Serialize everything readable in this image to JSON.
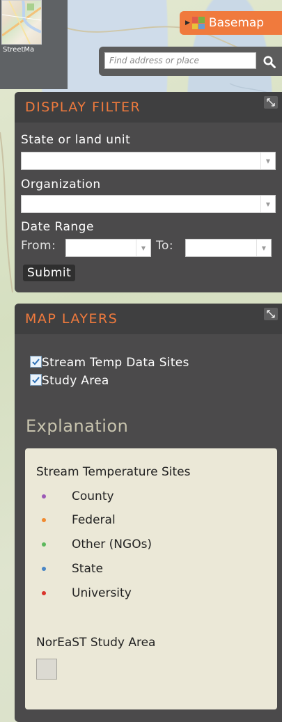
{
  "basemap_thumbnail": {
    "label": "StreetMa"
  },
  "basemap_button": {
    "label": "Basemap"
  },
  "search": {
    "placeholder": "Find address or place"
  },
  "display_filter": {
    "title": "DISPLAY FILTER",
    "state_label": "State or land unit",
    "state_value": "",
    "organization_label": "Organization",
    "organization_value": "",
    "date_range_label": "Date Range",
    "from_label": "From:",
    "to_label": "To:",
    "submit_label": "Submit"
  },
  "map_layers": {
    "title": "MAP LAYERS",
    "layers": [
      {
        "label": "Stream Temp Data Sites",
        "checked": true
      },
      {
        "label": "Study Area",
        "checked": true
      }
    ],
    "explanation_title": "Explanation",
    "legend": {
      "heading": "Stream Temperature Sites",
      "items": [
        {
          "label": "County",
          "color": "#9b59b6"
        },
        {
          "label": "Federal",
          "color": "#f08a30"
        },
        {
          "label": "Other (NGOs)",
          "color": "#5cb85c"
        },
        {
          "label": "State",
          "color": "#4a86c5"
        },
        {
          "label": "University",
          "color": "#d9342b"
        }
      ],
      "study_area_label": "NorEaST Study Area"
    }
  },
  "colors": {
    "accent": "#f07a3d",
    "panel": "#4b4a4b",
    "panel_header": "#3f3f40",
    "legend_bg": "#ebe8d7"
  }
}
